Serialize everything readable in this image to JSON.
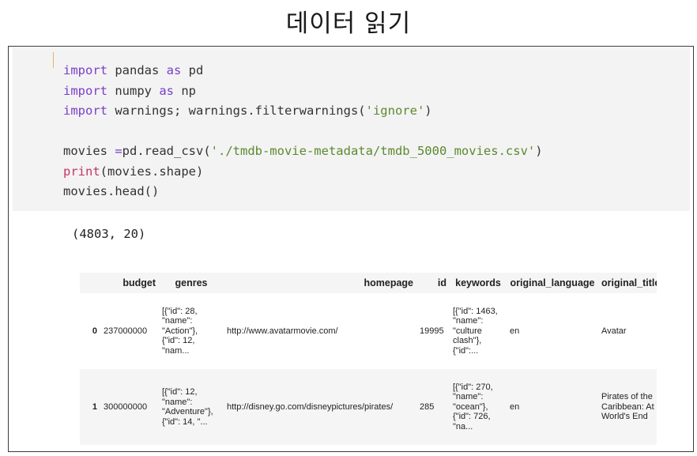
{
  "title": "데이터 읽기",
  "code_lines": {
    "l1_kw": "import",
    "l1_mod": " pandas ",
    "l1_as": "as",
    "l1_alias": " pd",
    "l2_kw": "import",
    "l2_mod": " numpy ",
    "l2_as": "as",
    "l2_alias": " np",
    "l3_kw": "import",
    "l3_rest": " warnings; warnings.filterwarnings(",
    "l3_str": "'ignore'",
    "l3_end": ")",
    "l5_var": "movies ",
    "l5_op": "=",
    "l5_call": "pd.read_csv(",
    "l5_str": "'./tmdb-movie-metadata/tmdb_5000_movies.csv'",
    "l5_end": ")",
    "l6_fn": "print",
    "l6_rest": "(movies.shape)",
    "l7": "movies.head()"
  },
  "output": {
    "shape": "(4803, 20)"
  },
  "dataframe": {
    "columns": [
      "",
      "budget",
      "genres",
      "homepage",
      "id",
      "keywords",
      "original_language",
      "original_title"
    ],
    "rows": [
      {
        "index": "0",
        "budget": "237000000",
        "genres": "[{\"id\": 28,\n\"name\":\n\"Action\"},\n{\"id\": 12,\n\"nam...",
        "homepage": "http://www.avatarmovie.com/",
        "id": "19995",
        "keywords": "[{\"id\": 1463,\n\"name\":\n\"culture\nclash\"},\n{\"id\":...",
        "original_language": "en",
        "original_title": "Avatar"
      },
      {
        "index": "1",
        "budget": "300000000",
        "genres": "[{\"id\": 12,\n\"name\":\n\"Adventure\"},\n{\"id\": 14, \"...",
        "homepage": "http://disney.go.com/disneypictures/pirates/",
        "id": "285",
        "keywords": "[{\"id\": 270,\n\"name\":\n\"ocean\"},\n{\"id\": 726,\n\"na...",
        "original_language": "en",
        "original_title": "Pirates of the\nCaribbean: At\nWorld's End"
      }
    ]
  }
}
